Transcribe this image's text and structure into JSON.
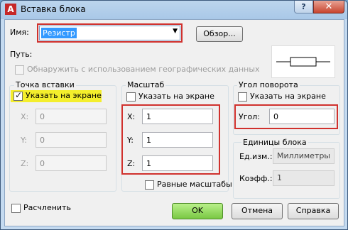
{
  "window": {
    "title": "Вставка блока",
    "app_icon": "autocad-icon",
    "help_glyph": "?",
    "close_glyph": "✕"
  },
  "name": {
    "label": "Имя:",
    "value": "Резистр",
    "browse_label": "Обзор..."
  },
  "path": {
    "label": "Путь:",
    "geo_label": "Обнаружить с использованием географических данных",
    "geo_checked": false
  },
  "insertion": {
    "title": "Точка вставки",
    "specify_label": "Указать на экране",
    "specify_checked": true,
    "x_label": "X:",
    "x_value": "0",
    "y_label": "Y:",
    "y_value": "0",
    "z_label": "Z:",
    "z_value": "0"
  },
  "scale": {
    "title": "Масштаб",
    "specify_label": "Указать на экране",
    "specify_checked": false,
    "x_label": "X:",
    "x_value": "1",
    "y_label": "Y:",
    "y_value": "1",
    "z_label": "Z:",
    "z_value": "1",
    "uniform_label": "Равные масштабы",
    "uniform_checked": false
  },
  "rotation": {
    "title": "Угол поворота",
    "specify_label": "Указать на экране",
    "specify_checked": false,
    "angle_label": "Угол:",
    "angle_value": "0"
  },
  "units": {
    "title": "Единицы блока",
    "unit_label": "Ед.изм.:",
    "unit_value": "Миллиметры",
    "factor_label": "Коэфф.:",
    "factor_value": "1"
  },
  "explode": {
    "label": "Расчленить",
    "checked": false
  },
  "buttons": {
    "ok": "OK",
    "cancel": "Отмена",
    "help": "Справка"
  },
  "colors": {
    "highlight_red": "#d0312d",
    "highlight_yellow": "#f4ee2c",
    "ok_green": "#8fd35a"
  }
}
